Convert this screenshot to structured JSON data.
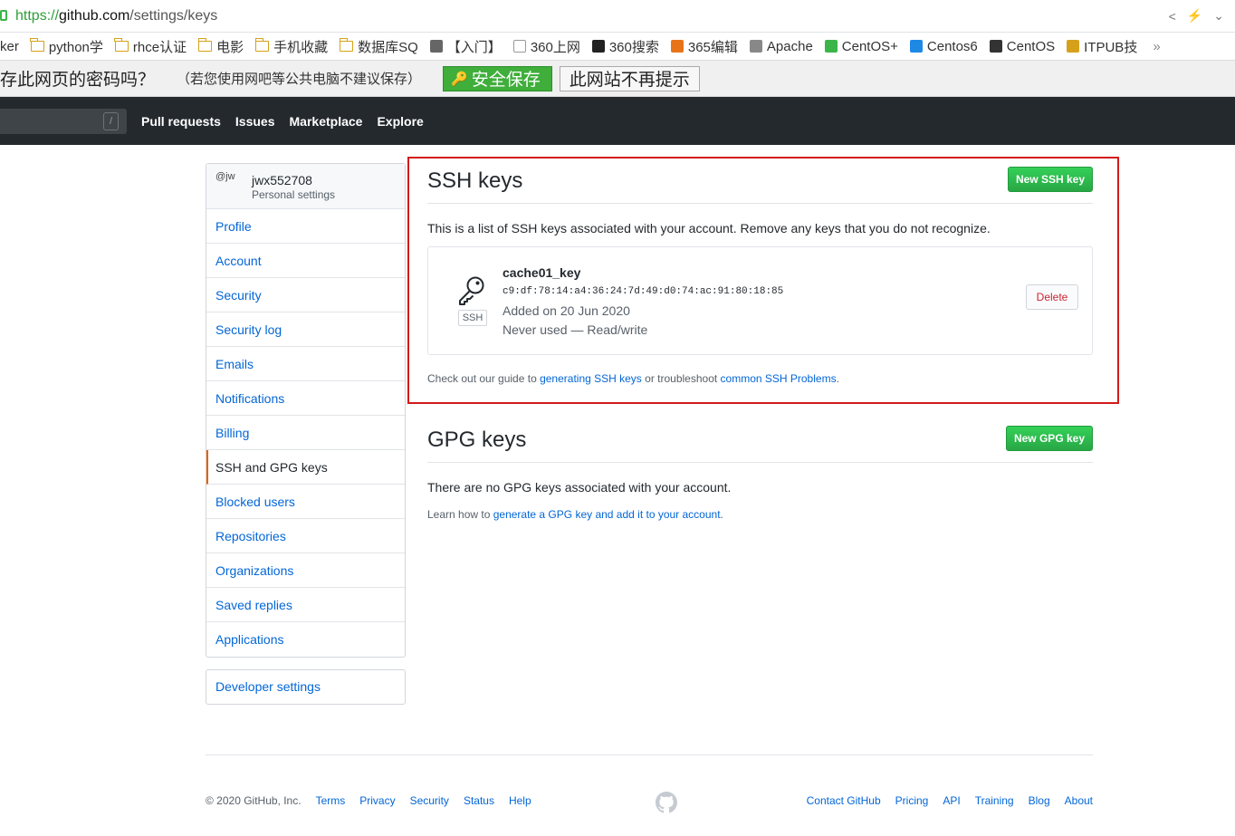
{
  "browser": {
    "url_scheme": "https://",
    "url_host": "github.com",
    "url_path": "/settings/keys"
  },
  "bookmarks": [
    {
      "label": "ker",
      "icon": "none"
    },
    {
      "label": "python学",
      "icon": "folder-icon"
    },
    {
      "label": "rhce认证",
      "icon": "folder-icon"
    },
    {
      "label": "电影",
      "icon": "folder-icon"
    },
    {
      "label": "手机收藏",
      "icon": "folder-icon"
    },
    {
      "label": "数据库SQ",
      "icon": "folder-icon"
    },
    {
      "label": "【入门】",
      "icon": "site-icon"
    },
    {
      "label": "360上网",
      "icon": "page-icon"
    },
    {
      "label": "360搜索",
      "icon": "site-icon"
    },
    {
      "label": "365编辑",
      "icon": "site-icon"
    },
    {
      "label": "Apache",
      "icon": "site-icon"
    },
    {
      "label": "CentOS+",
      "icon": "site-icon"
    },
    {
      "label": "Centos6",
      "icon": "site-icon"
    },
    {
      "label": "CentOS",
      "icon": "site-icon"
    },
    {
      "label": "ITPUB技",
      "icon": "site-icon"
    }
  ],
  "bookmarks_more": "»",
  "password_bar": {
    "question": "存此网页的密码吗？",
    "note": "（若您使用网吧等公共电脑不建议保存）",
    "save_label": "安全保存",
    "never_label": "此网站不再提示"
  },
  "header": {
    "search_hint": "/",
    "nav": [
      "Pull requests",
      "Issues",
      "Marketplace",
      "Explore"
    ]
  },
  "sidebar": {
    "avatar_alt": "@jw",
    "username": "jwx552708",
    "subtitle": "Personal settings",
    "items": [
      {
        "label": "Profile",
        "selected": false
      },
      {
        "label": "Account",
        "selected": false
      },
      {
        "label": "Security",
        "selected": false
      },
      {
        "label": "Security log",
        "selected": false
      },
      {
        "label": "Emails",
        "selected": false
      },
      {
        "label": "Notifications",
        "selected": false
      },
      {
        "label": "Billing",
        "selected": false
      },
      {
        "label": "SSH and GPG keys",
        "selected": true
      },
      {
        "label": "Blocked users",
        "selected": false
      },
      {
        "label": "Repositories",
        "selected": false
      },
      {
        "label": "Organizations",
        "selected": false
      },
      {
        "label": "Saved replies",
        "selected": false
      },
      {
        "label": "Applications",
        "selected": false
      }
    ],
    "developer_settings": "Developer settings"
  },
  "ssh": {
    "title": "SSH keys",
    "new_button": "New SSH key",
    "description": "This is a list of SSH keys associated with your account. Remove any keys that you do not recognize.",
    "key": {
      "badge": "SSH",
      "name": "cache01_key",
      "fingerprint": "c9:df:78:14:a4:36:24:7d:49:d0:74:ac:91:80:18:85",
      "added": "Added on 20 Jun 2020",
      "usage": "Never used — Read/write",
      "delete_label": "Delete"
    },
    "guide_prefix": "Check out our guide to ",
    "guide_link1": "generating SSH keys",
    "guide_middle": " or troubleshoot ",
    "guide_link2": "common SSH Problems",
    "guide_suffix": "."
  },
  "gpg": {
    "title": "GPG keys",
    "new_button": "New GPG key",
    "empty_text": "There are no GPG keys associated with your account.",
    "learn_prefix": "Learn how to ",
    "learn_link": "generate a GPG key and add it to your account",
    "learn_suffix": "."
  },
  "footer": {
    "copyright": "© 2020 GitHub, Inc.",
    "left_links": [
      "Terms",
      "Privacy",
      "Security",
      "Status",
      "Help"
    ],
    "right_links": [
      "Contact GitHub",
      "Pricing",
      "API",
      "Training",
      "Blog",
      "About"
    ]
  },
  "colors": {
    "accent_green": "#28a745",
    "link_blue": "#0366d6",
    "header_dark": "#24292e",
    "highlight_red": "#d21a1a",
    "selected_orange": "#e36209"
  }
}
